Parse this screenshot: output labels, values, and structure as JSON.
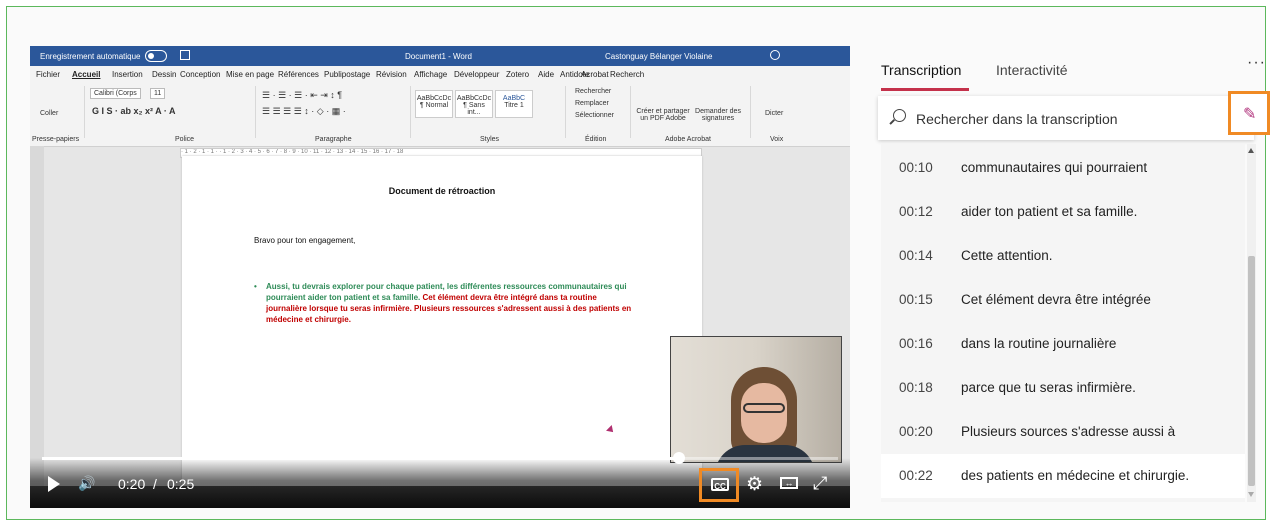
{
  "video": {
    "word": {
      "autosave_label": "Enregistrement automatique",
      "doc_name": "Document1 - Word",
      "user_name": "Castonguay Bélanger Violaine",
      "menu": [
        "Fichier",
        "Accueil",
        "Insertion",
        "Dessin",
        "Conception",
        "Mise en page",
        "Références",
        "Publipostage",
        "Révision",
        "Affichage",
        "Développeur",
        "Zotero",
        "Aide",
        "Antidote",
        "Acrobat",
        "Recherch"
      ],
      "ribbon": {
        "paste": "Coller",
        "clipboard": "Presse-papiers",
        "font_name": "Calibri (Corps",
        "font_size": "11",
        "police": "Police",
        "paragraphe": "Paragraphe",
        "styles_label": "Styles",
        "style1": "AaBbCcDc",
        "style1_name": "¶ Normal",
        "style2": "AaBbCcDc",
        "style2_name": "¶ Sans int...",
        "style3": "AaBbC",
        "style3_name": "Titre 1",
        "rechercher": "Rechercher",
        "remplacer": "Remplacer",
        "selectionner": "Sélectionner",
        "edition": "Édition",
        "creer_pdf": "Créer et partager un PDF Adobe",
        "demander": "Demander des signatures",
        "adobe": "Adobe Acrobat",
        "dicter": "Dicter",
        "voix": "Voix"
      },
      "doc_title": "Document de rétroaction",
      "doc_greeting": "Bravo pour ton engagement,",
      "bullet_green": "Aussi, tu devrais explorer pour chaque patient, les différentes ressources communautaires qui pourraient aider ton patient et sa famille.",
      "bullet_red": "Cet élément devra être intégré dans ta routine journalière lorsque tu seras infirmière.  Plusieurs ressources s'adressent aussi à des patients en médecine et chirurgie."
    },
    "player": {
      "time_current": "0:20",
      "time_sep": "/",
      "time_total": "0:25",
      "progress": 0.8,
      "cc_label": "CC",
      "vol_glyph": "🔊",
      "gear_glyph": "⚙",
      "fit_glyph": "↔",
      "fullscreen_glyph": "⤢"
    }
  },
  "panel": {
    "tabs": [
      "Transcription",
      "Interactivité"
    ],
    "active_tab": "Transcription",
    "more_glyph": "···",
    "search_placeholder": "Rechercher dans la transcription",
    "pencil_glyph": "✎",
    "accent_color": "#c4314b",
    "highlight_color": "#f08a24",
    "rows": [
      {
        "time": "00:10",
        "text": "communautaires qui pourraient"
      },
      {
        "time": "00:12",
        "text": "aider ton patient et sa famille."
      },
      {
        "time": "00:14",
        "text": "Cette attention."
      },
      {
        "time": "00:15",
        "text": "Cet élément devra être intégrée"
      },
      {
        "time": "00:16",
        "text": "dans la routine journalière"
      },
      {
        "time": "00:18",
        "text": "parce que tu seras infirmière."
      },
      {
        "time": "00:20",
        "text": "Plusieurs sources s'adresse aussi à"
      },
      {
        "time": "00:22",
        "text": "des patients en médecine et chirurgie."
      }
    ],
    "active_row": 7
  }
}
